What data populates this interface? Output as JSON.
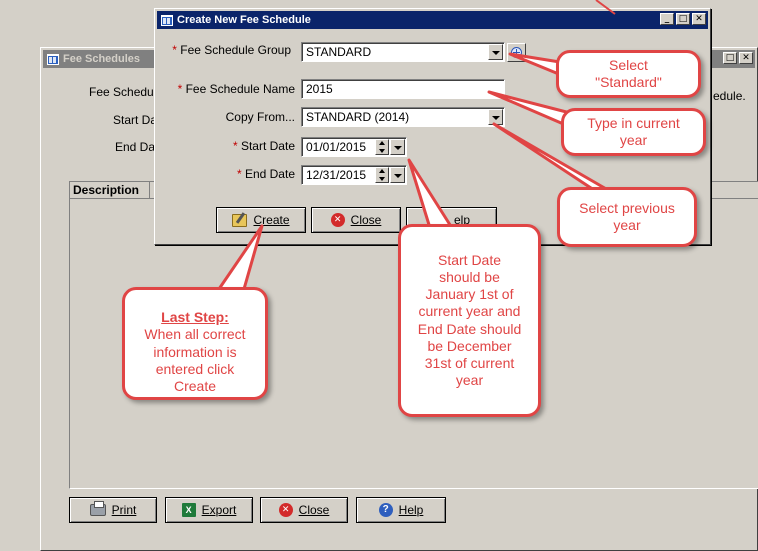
{
  "back_window": {
    "title": "Fee Schedules",
    "fee_schedule_label": "Fee Schedu",
    "start_date_label": "Start Da",
    "end_date_label": "End Da",
    "right_text": "edule.",
    "description_header": "Description",
    "buttons": {
      "print": "Print",
      "export": "Export",
      "close": "Close",
      "help": "Help"
    }
  },
  "dialog": {
    "title": "Create New Fee Schedule",
    "fields": {
      "group_label": "Fee Schedule Group",
      "group_value": "STANDARD",
      "name_label": "Fee Schedule Name",
      "name_value": "2015",
      "copy_from_label": "Copy From...",
      "copy_from_value": "STANDARD (2014)",
      "start_date_label": "Start Date",
      "start_date_value": "01/01/2015",
      "end_date_label": "End Date",
      "end_date_value": "12/31/2015"
    },
    "required_marker": "*",
    "buttons": {
      "create": "Create",
      "close": "Close",
      "help": "elp"
    }
  },
  "callouts": {
    "select_standard": "Select\n\"Standard\"",
    "type_year": "Type in current\nyear",
    "select_previous": "Select previous\nyear",
    "dates": "Start Date\nshould be\nJanuary 1st of\ncurrent year and\nEnd Date should\nbe December\n31st of current\nyear",
    "last_step_title": "Last Step:",
    "last_step_body": "When all correct\ninformation is\nentered click\nCreate"
  },
  "colors": {
    "callout_red": "#e04545",
    "title_active": "#0a246a",
    "title_inactive": "#808080",
    "face": "#d4d0c8"
  }
}
